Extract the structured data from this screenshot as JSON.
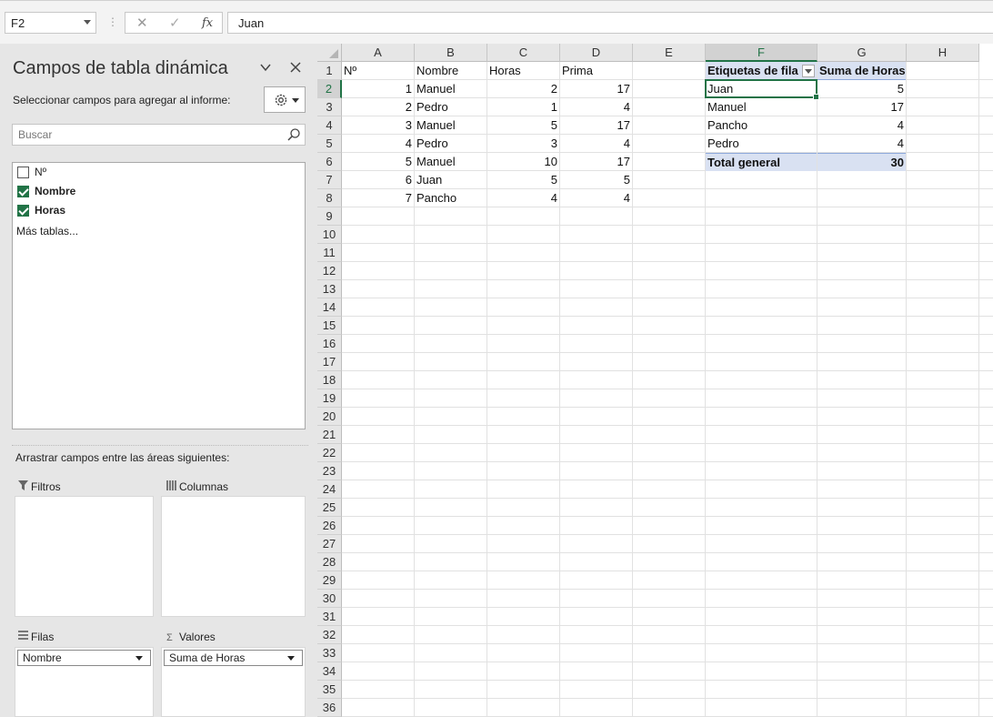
{
  "formula_bar": {
    "name_box": "F2",
    "cancel_icon": "✕",
    "enter_icon": "✓",
    "fx_label": "fx",
    "formula": "Juan"
  },
  "pivot_pane": {
    "title": "Campos de tabla dinámica",
    "subtitle": "Seleccionar campos para agregar al informe:",
    "search_placeholder": "Buscar",
    "fields": [
      {
        "label": "Nº",
        "checked": false
      },
      {
        "label": "Nombre",
        "checked": true
      },
      {
        "label": "Horas",
        "checked": true
      }
    ],
    "more_tables": "Más tablas...",
    "drag_label": "Arrastrar campos entre las áreas siguientes:",
    "areas": {
      "filters": {
        "label": "Filtros"
      },
      "columns": {
        "label": "Columnas"
      },
      "rows": {
        "label": "Filas",
        "item": "Nombre"
      },
      "values": {
        "label": "Valores",
        "icon": "Σ",
        "item": "Suma de Horas"
      }
    }
  },
  "sheet": {
    "columns": [
      "A",
      "B",
      "C",
      "D",
      "E",
      "F",
      "G",
      "H"
    ],
    "selected_column": "F",
    "selected_row": 2,
    "row_count": 36,
    "data_table": {
      "headers": [
        "Nº",
        "Nombre",
        "Horas",
        "Prima"
      ],
      "rows": [
        [
          "1",
          "Manuel",
          "2",
          "17"
        ],
        [
          "2",
          "Pedro",
          "1",
          "4"
        ],
        [
          "3",
          "Manuel",
          "5",
          "17"
        ],
        [
          "4",
          "Pedro",
          "3",
          "4"
        ],
        [
          "5",
          "Manuel",
          "10",
          "17"
        ],
        [
          "6",
          "Juan",
          "5",
          "5"
        ],
        [
          "7",
          "Pancho",
          "4",
          "4"
        ]
      ]
    },
    "pivot_table": {
      "row_label_header": "Etiquetas de fila",
      "value_header": "Suma de Horas",
      "rows": [
        [
          "Juan",
          "5"
        ],
        [
          "Manuel",
          "17"
        ],
        [
          "Pancho",
          "4"
        ],
        [
          "Pedro",
          "4"
        ]
      ],
      "total_label": "Total general",
      "total_value": "30"
    }
  }
}
